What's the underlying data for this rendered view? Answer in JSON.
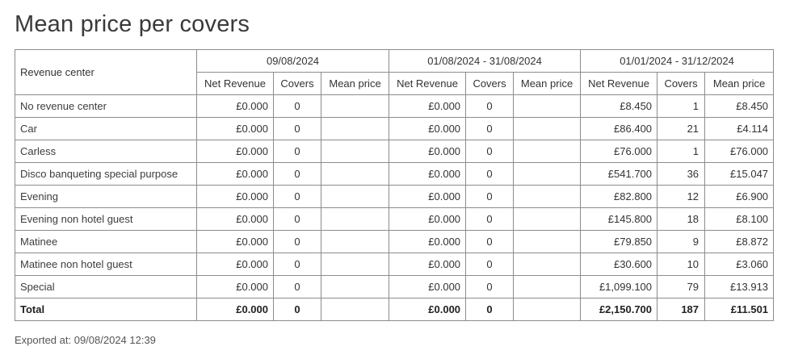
{
  "title": "Mean price per covers",
  "header": {
    "revenue_center": "Revenue center",
    "periods": [
      "09/08/2024",
      "01/08/2024 - 31/08/2024",
      "01/01/2024 - 31/12/2024"
    ],
    "columns": [
      "Net Revenue",
      "Covers",
      "Mean price"
    ]
  },
  "rows": [
    {
      "name": "No revenue center",
      "p1": [
        "£0.000",
        "0",
        ""
      ],
      "p2": [
        "£0.000",
        "0",
        ""
      ],
      "p3": [
        "£8.450",
        "1",
        "£8.450"
      ]
    },
    {
      "name": "Car",
      "p1": [
        "£0.000",
        "0",
        ""
      ],
      "p2": [
        "£0.000",
        "0",
        ""
      ],
      "p3": [
        "£86.400",
        "21",
        "£4.114"
      ]
    },
    {
      "name": "Carless",
      "p1": [
        "£0.000",
        "0",
        ""
      ],
      "p2": [
        "£0.000",
        "0",
        ""
      ],
      "p3": [
        "£76.000",
        "1",
        "£76.000"
      ]
    },
    {
      "name": "Disco banqueting special purpose",
      "p1": [
        "£0.000",
        "0",
        ""
      ],
      "p2": [
        "£0.000",
        "0",
        ""
      ],
      "p3": [
        "£541.700",
        "36",
        "£15.047"
      ]
    },
    {
      "name": "Evening",
      "p1": [
        "£0.000",
        "0",
        ""
      ],
      "p2": [
        "£0.000",
        "0",
        ""
      ],
      "p3": [
        "£82.800",
        "12",
        "£6.900"
      ]
    },
    {
      "name": "Evening non hotel guest",
      "p1": [
        "£0.000",
        "0",
        ""
      ],
      "p2": [
        "£0.000",
        "0",
        ""
      ],
      "p3": [
        "£145.800",
        "18",
        "£8.100"
      ]
    },
    {
      "name": "Matinee",
      "p1": [
        "£0.000",
        "0",
        ""
      ],
      "p2": [
        "£0.000",
        "0",
        ""
      ],
      "p3": [
        "£79.850",
        "9",
        "£8.872"
      ]
    },
    {
      "name": "Matinee non hotel guest",
      "p1": [
        "£0.000",
        "0",
        ""
      ],
      "p2": [
        "£0.000",
        "0",
        ""
      ],
      "p3": [
        "£30.600",
        "10",
        "£3.060"
      ]
    },
    {
      "name": "Special",
      "p1": [
        "£0.000",
        "0",
        ""
      ],
      "p2": [
        "£0.000",
        "0",
        ""
      ],
      "p3": [
        "£1,099.100",
        "79",
        "£13.913"
      ]
    }
  ],
  "total": {
    "name": "Total",
    "p1": [
      "£0.000",
      "0",
      ""
    ],
    "p2": [
      "£0.000",
      "0",
      ""
    ],
    "p3": [
      "£2,150.700",
      "187",
      "£11.501"
    ]
  },
  "exported": "Exported at: 09/08/2024 12:39"
}
